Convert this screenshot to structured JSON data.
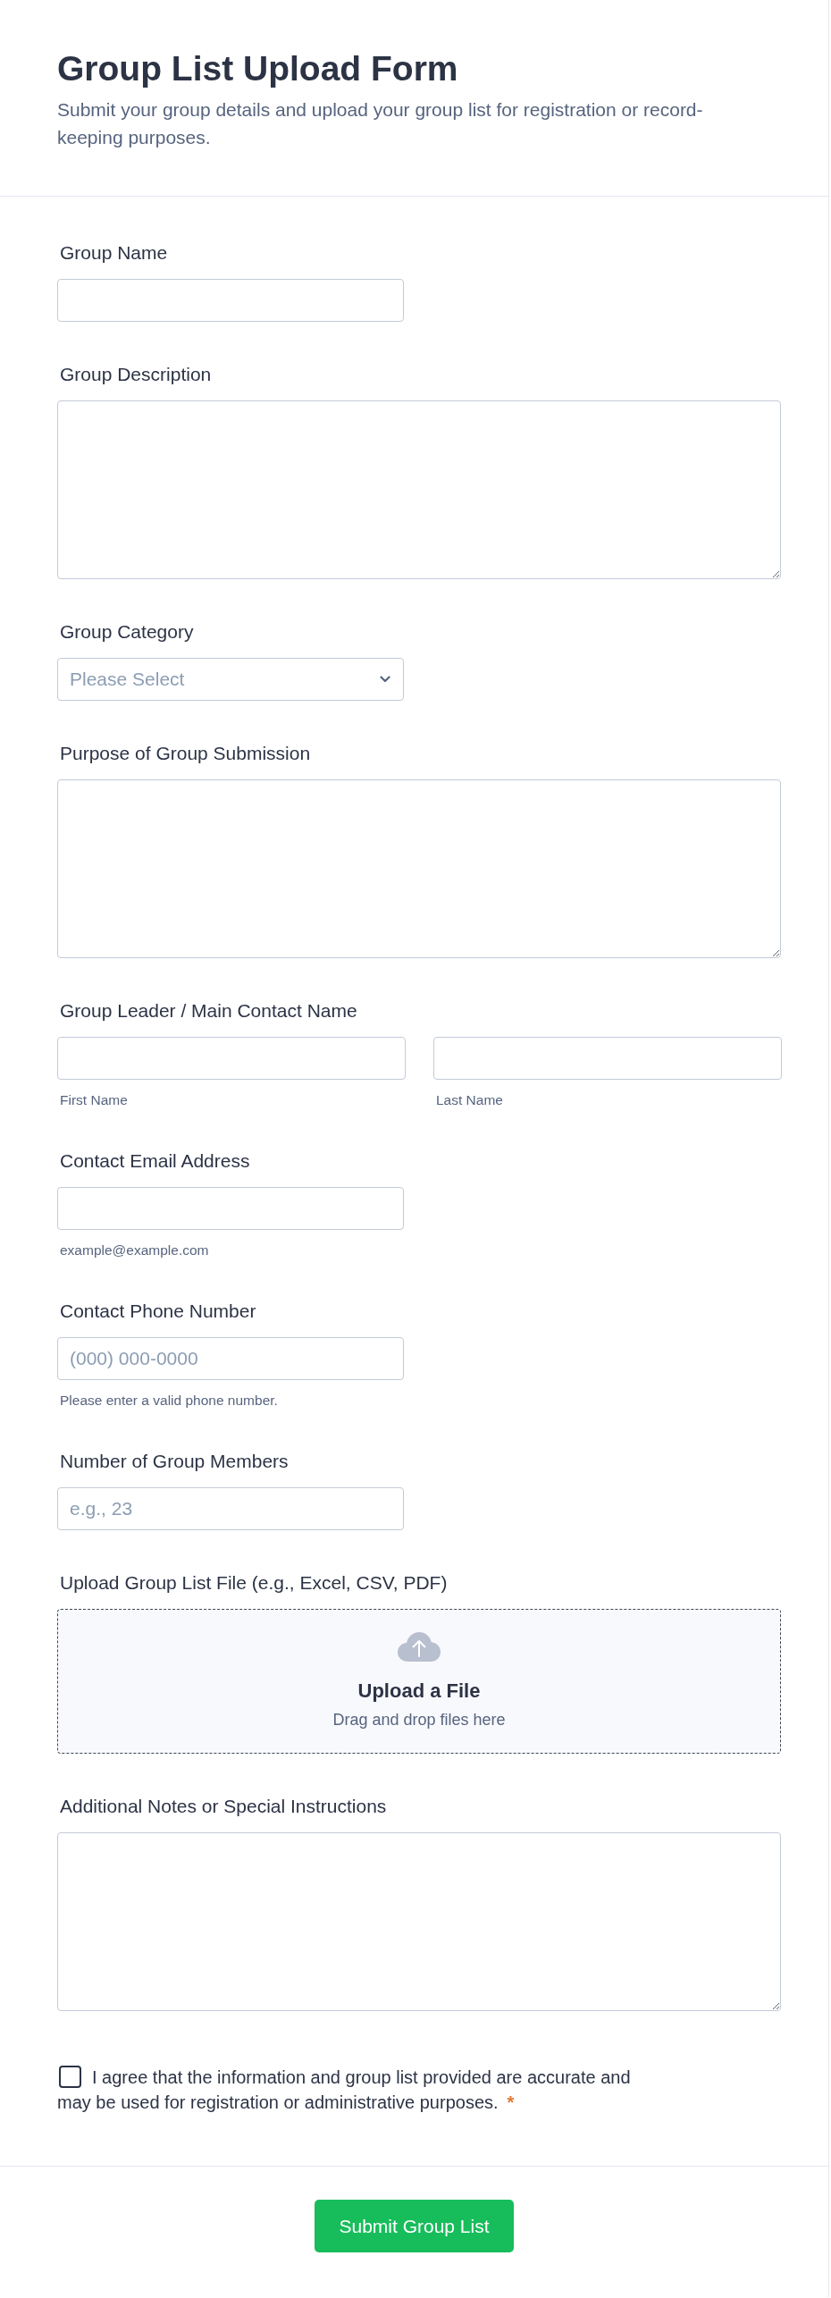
{
  "header": {
    "title": "Group List Upload Form",
    "subtitle": "Submit your group details and upload your group list for registration or record-keeping purposes."
  },
  "fields": [
    {
      "kind": "text",
      "label": "Group Name"
    },
    {
      "kind": "textarea",
      "label": "Group Description"
    },
    {
      "kind": "select",
      "label": "Group Category",
      "placeholder": "Please Select"
    },
    {
      "kind": "textarea",
      "label": "Purpose of Group Submission"
    },
    {
      "kind": "name",
      "label": "Group Leader / Main Contact Name",
      "parts": [
        {
          "sublabel": "First Name"
        },
        {
          "sublabel": "Last Name"
        }
      ]
    },
    {
      "kind": "text",
      "label": "Contact Email Address",
      "sublabel": "example@example.com"
    },
    {
      "kind": "text",
      "label": "Contact Phone Number",
      "placeholder": "(000) 000-0000",
      "sublabel": "Please enter a valid phone number."
    },
    {
      "kind": "text",
      "label": "Number of Group Members",
      "placeholder": "e.g., 23"
    },
    {
      "kind": "upload",
      "label": "Upload Group List File (e.g., Excel, CSV, PDF)",
      "title": "Upload a File",
      "hint": "Drag and drop files here"
    },
    {
      "kind": "textarea",
      "label": "Additional Notes or Special Instructions"
    },
    {
      "kind": "checkbox",
      "text": "I agree that the information and group list provided are accurate and may be used for registration or administrative purposes.",
      "checked": false,
      "required_mark": "*"
    }
  ],
  "submit": {
    "label": "Submit Group List"
  }
}
